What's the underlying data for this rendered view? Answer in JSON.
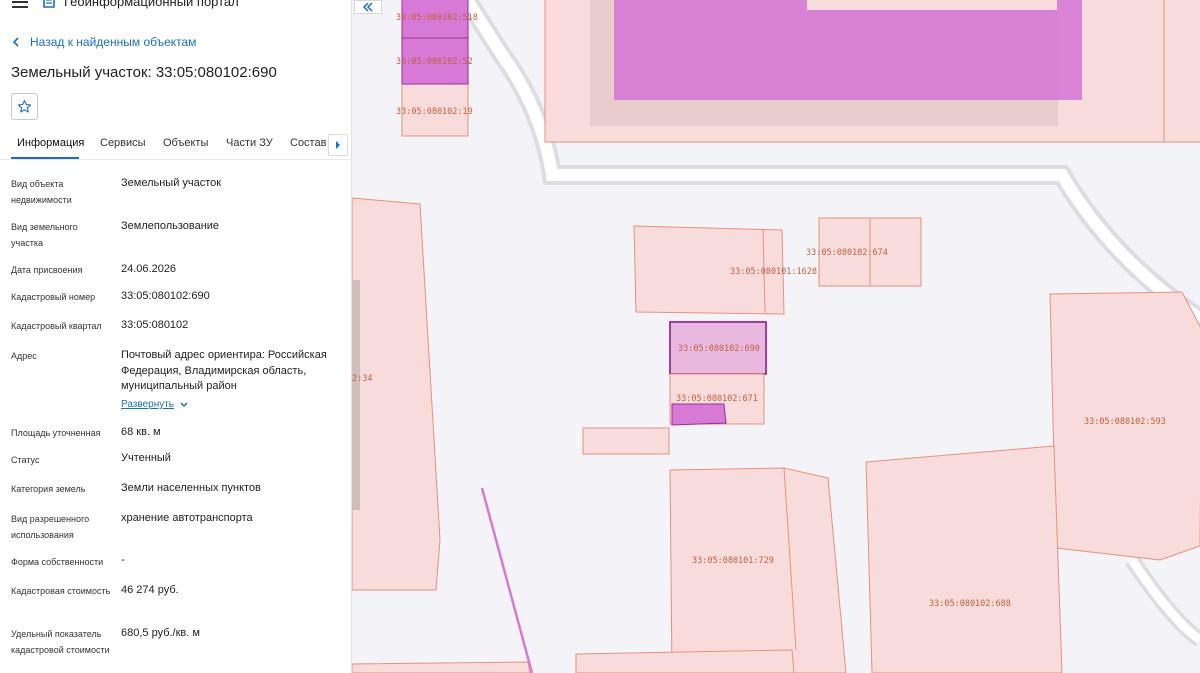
{
  "header": {
    "portal_title": "Геоинформационный портал"
  },
  "nav": {
    "back_label": "Назад к найденным объектам"
  },
  "object": {
    "title": "Земельный участок: 33:05:080102:690"
  },
  "tabs": [
    "Информация",
    "Сервисы",
    "Объекты",
    "Части ЗУ",
    "Состав"
  ],
  "fields": [
    {
      "label": "Вид объекта недвижимости",
      "value": "Земельный участок"
    },
    {
      "label": "Вид земельного участка",
      "value": "Землепользование"
    },
    {
      "label": "Дата присвоения",
      "value": "24.06.2026"
    },
    {
      "label": "Кадастровый номер",
      "value": "33:05:080102:690"
    },
    {
      "label": "Кадастровый квартал",
      "value": "33:05:080102"
    },
    {
      "label": "Адрес",
      "value": "Почтовый адрес ориентира: Российская Федерация, Владимирская область, муниципальный район"
    },
    {
      "label": "Площадь уточненная",
      "value": "68 кв. м"
    },
    {
      "label": "Статус",
      "value": "Учтенный"
    },
    {
      "label": "Категория земель",
      "value": "Земли населенных пунктов"
    },
    {
      "label": "Вид разрешенного использования",
      "value": "хранение автотранспорта"
    },
    {
      "label": "Форма собственности",
      "value": "-"
    },
    {
      "label": "Кадастровая стоимость",
      "value": "46 274 руб."
    },
    {
      "label": "Удельный показатель кадастровой стоимости",
      "value": "680,5 руб./кв. м"
    }
  ],
  "address_expand_label": "Развернуть",
  "map": {
    "parcel_labels": [
      "33:05:080102:518",
      "33:05:080102:52",
      "33:05:080102:19",
      "33:05:080102:674",
      "33:05:080101:1628",
      "33:05:080102:690",
      "33:05:080102:671",
      "2:34",
      "33:05:080102:593",
      "33:05:080101:729",
      "33:05:080102:688"
    ]
  },
  "colors": {
    "accent": "#1a6fc4",
    "parcel_fill": "#f8dcdc",
    "parcel_stroke": "#e8907a",
    "highlight": "#d67ad6",
    "selected_stroke": "#9c2a9c",
    "label": "#c0603c"
  },
  "icons": [
    "menu-icon",
    "portal-logo-icon",
    "chevron-left-icon",
    "star-icon",
    "chevron-right-icon",
    "chevron-down-icon",
    "double-chevron-left-icon"
  ]
}
